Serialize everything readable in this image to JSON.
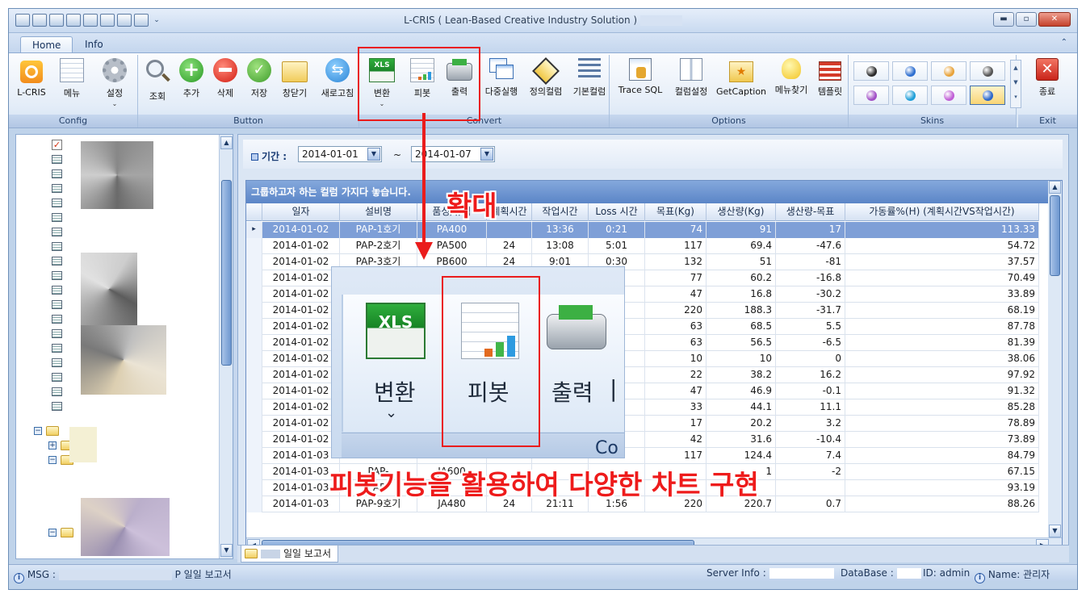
{
  "window": {
    "title": "L-CRIS ( Lean-Based Creative Industry Solution )",
    "controls": {
      "minimize": "▬",
      "restore": "▫",
      "close": "✕"
    }
  },
  "ribbon": {
    "tabs": [
      {
        "label": "Home"
      },
      {
        "label": "Info"
      }
    ],
    "minimize_glyph": "⌃",
    "groups": {
      "config": {
        "label": "Config",
        "buttons": [
          "L-CRIS",
          "메뉴",
          "설정"
        ]
      },
      "button": {
        "label": "Button",
        "buttons": [
          "조회",
          "추가",
          "삭제",
          "저장",
          "창닫기",
          "새로고침"
        ]
      },
      "convert": {
        "label": "Convert",
        "buttons": [
          "변환",
          "피봇",
          "출력",
          "다중실행",
          "정의컬럼",
          "기본컬럼"
        ]
      },
      "options": {
        "label": "Options",
        "buttons": [
          "Trace SQL",
          "컬럼설정",
          "GetCaption",
          "메뉴찾기",
          "템플릿"
        ]
      },
      "skins": {
        "label": "Skins"
      },
      "exit": {
        "label": "Exit",
        "buttons": [
          "종료"
        ]
      }
    },
    "xls_badge": "XLS",
    "dropdown_glyph": "⌄",
    "skin_colors": [
      "#2b2b2b",
      "#2f6fd0",
      "#e8a33b",
      "#555555",
      "#a14fc6",
      "#1f9fd8",
      "#c05fd6",
      "#2d67c9"
    ]
  },
  "filter": {
    "label": "기간 :",
    "from": "2014-01-01",
    "tilde": "~",
    "to": "2014-01-07"
  },
  "grid": {
    "group_hint": "그룹하고자 하는 컬럼 가지다 놓습니다.",
    "columns": [
      "일자",
      "설비명",
      "품성/규격",
      "계획시간",
      "작업시간",
      "Loss 시간",
      "목표(Kg)",
      "생산량(Kg)",
      "생산량-목표",
      "가동률%(H) (계획시간VS작업시간)"
    ],
    "rows": [
      [
        "2014-01-02",
        "PAP-1호기",
        "PA400",
        "",
        "13:36",
        "0:21",
        "74",
        "91",
        "17",
        "113.33"
      ],
      [
        "2014-01-02",
        "PAP-2호기",
        "PA500",
        "24",
        "13:08",
        "5:01",
        "117",
        "69.4",
        "-47.6",
        "54.72"
      ],
      [
        "2014-01-02",
        "PAP-3호기",
        "PB600",
        "24",
        "9:01",
        "0:30",
        "132",
        "51",
        "-81",
        "37.57"
      ],
      [
        "2014-01-02",
        "",
        "",
        "",
        "",
        ":36",
        "77",
        "60.2",
        "-16.8",
        "70.49"
      ],
      [
        "2014-01-02",
        "",
        "",
        "",
        "",
        ":22",
        "47",
        "16.8",
        "-30.2",
        "33.89"
      ],
      [
        "2014-01-02",
        "",
        "",
        "",
        "",
        ":13",
        "220",
        "188.3",
        "-31.7",
        "68.19"
      ],
      [
        "2014-01-02",
        "",
        "",
        "",
        "",
        ":04",
        "63",
        "68.5",
        "5.5",
        "87.78"
      ],
      [
        "2014-01-02",
        "",
        "",
        "",
        "",
        ":55",
        "63",
        "56.5",
        "-6.5",
        "81.39"
      ],
      [
        "2014-01-02",
        "",
        "",
        "",
        "",
        ":35",
        "10",
        "10",
        "0",
        "38.06"
      ],
      [
        "2014-01-02",
        "",
        "",
        "",
        "",
        ":35",
        "22",
        "38.2",
        "16.2",
        "97.92"
      ],
      [
        "2014-01-02",
        "",
        "",
        "",
        "",
        ":19",
        "47",
        "46.9",
        "-0.1",
        "91.32"
      ],
      [
        "2014-01-02",
        "",
        "",
        "",
        "",
        ":31",
        "33",
        "44.1",
        "11.1",
        "85.28"
      ],
      [
        "2014-01-02",
        "",
        "",
        "",
        "",
        ":19",
        "17",
        "20.2",
        "3.2",
        "78.89"
      ],
      [
        "2014-01-02",
        "",
        "",
        "",
        "",
        ":33",
        "42",
        "31.6",
        "-10.4",
        "73.89"
      ],
      [
        "2014-01-03",
        "",
        "",
        "",
        "",
        ":55",
        "117",
        "124.4",
        "7.4",
        "84.79"
      ],
      [
        "2014-01-03",
        "PAP-",
        "JA600",
        "",
        "",
        "",
        "",
        "1",
        "-2",
        "67.15"
      ],
      [
        "2014-01-03",
        "PAP-",
        "",
        "",
        "",
        "",
        "",
        "",
        "",
        "93.19"
      ],
      [
        "2014-01-03",
        "PAP-9호기",
        "JA480",
        "24",
        "21:11",
        "1:56",
        "220",
        "220.7",
        "0.7",
        "88.26"
      ]
    ],
    "row_indicator": "▸"
  },
  "zoom": {
    "labels": [
      "변환",
      "피봇",
      "출력"
    ],
    "xls": "XLS",
    "convert_fragment": "Co"
  },
  "annotations": {
    "zoom": "확대",
    "caption": "피봇기능을 활용하여 다양한 차트 구현"
  },
  "doc_tab": {
    "label": "일일 보고서"
  },
  "status": {
    "msg_label": "MSG :",
    "msg_text": "P 일일 보고서",
    "server_label": "Server Info :",
    "db_label": "DataBase :",
    "id_label": "ID: admin",
    "name_label": "Name: 관리자"
  }
}
